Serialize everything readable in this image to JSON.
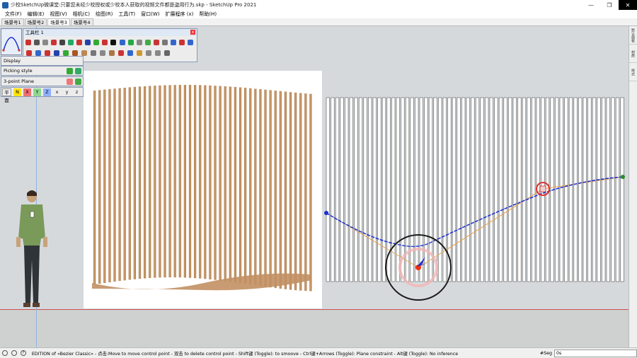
{
  "window": {
    "title": "少校SketchUp微课堂:只要您未经少校授权或少校本人获取的视频文件都是盗用行为.skp - SketchUp Pro 2021",
    "minimize": "—",
    "maximize": "❐",
    "close": "✕"
  },
  "menu": [
    "文件(F)",
    "编辑(E)",
    "视图(V)",
    "相机(C)",
    "绘图(R)",
    "工具(T)",
    "窗口(W)",
    "扩展程序 (x)",
    "帮助(H)"
  ],
  "scenes": [
    "场景号1",
    "场景号2",
    "场景号3",
    "场景号4"
  ],
  "active_scene": "场景号3",
  "toolbar": {
    "title": "工具栏 1",
    "close": "x",
    "row1_colors": [
      "#c33",
      "#555",
      "#888",
      "#c33",
      "#444",
      "#2a6",
      "#c33",
      "#24a",
      "#3a3",
      "#c33",
      "#111",
      "#36c",
      "#2a4",
      "#888",
      "#4a4",
      "#c33",
      "#777",
      "#36c",
      "#c33",
      "#36c"
    ],
    "row2_colors": [
      "#c33",
      "#36c",
      "#c33",
      "#24a",
      "#3a3",
      "#a52",
      "#b85",
      "#777",
      "#888",
      "#a74",
      "#c33",
      "#36c",
      "#c93",
      "#888",
      "#888",
      "#666"
    ]
  },
  "panels": {
    "display": "Display",
    "picking_style": "Picking style",
    "three_point_plane": "3-point Plane"
  },
  "axis_bar": [
    "平面",
    "N",
    "X",
    "Y",
    "Z",
    "x",
    "y",
    "z"
  ],
  "right_panel_tabs": [
    "默认面板",
    "材质",
    "样式"
  ],
  "statusbar": {
    "text": "EDITION of «Bezier Classic» - 点击:Move to move control point - 双击 to delete control point - Shift键 (Toggle): to smoove - Ctrl键+Arrows (Toggle): Plane constraint - Alt键 (Toggle): No inference",
    "measure_label": "#Seg",
    "measure_value": "0s"
  },
  "colors": {
    "curve": "#1a2fd0",
    "control_polygon": "#e8a24a",
    "red_axis": "#c95050",
    "slat_wood": "#c89a6a"
  }
}
